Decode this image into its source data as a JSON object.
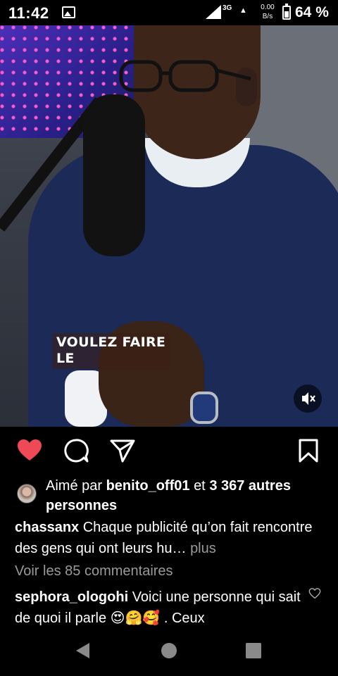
{
  "status_bar": {
    "time": "11:42",
    "network": "3G",
    "speed_value": "0.00",
    "speed_unit": "B/s",
    "battery_level": 0.64,
    "battery_percent": "64 %"
  },
  "video": {
    "caption_overlay": "VOULEZ FAIRE\nLE",
    "mute_icon": "speaker-muted-icon"
  },
  "actions": {
    "like_icon": "heart-filled-icon",
    "like_color": "#ed4956",
    "comment_icon": "comment-bubble-icon",
    "share_icon": "paper-plane-icon",
    "save_icon": "bookmark-icon"
  },
  "likes": {
    "prefix": "Aimé par",
    "user": "benito_off01",
    "connector": "et",
    "others": "3 367 autres personnes"
  },
  "post_caption": {
    "username": "chassanx",
    "text": "Chaque publicité qu’on fait rencontre des gens qui ont leurs hu…",
    "more_label": "plus"
  },
  "view_comments": "Voir les 85 commentaires",
  "comment": {
    "username": "sephora_ologohi",
    "text": "Voici une personne qui sait de quoi il parle 😍🤗🥰 . Ceux"
  },
  "navbar": {
    "back_icon": "back-triangle-icon",
    "home_icon": "home-circle-icon",
    "recents_icon": "recents-square-icon"
  }
}
